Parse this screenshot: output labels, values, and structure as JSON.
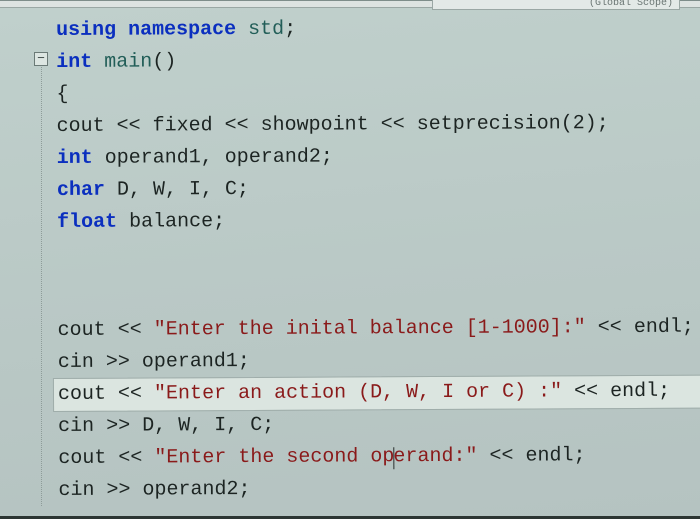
{
  "scope_label": "(Global Scope)",
  "fold_glyph": "−",
  "code": {
    "l1": {
      "kw1": "using",
      "kw2": "namespace",
      "id": "std",
      "end": ";"
    },
    "l2": {
      "kw": "int",
      "fn": "main",
      "paren": "()"
    },
    "l3": "{",
    "l4": {
      "a": "cout ",
      "op1": "<<",
      "b": " fixed ",
      "op2": "<<",
      "c": " showpoint ",
      "op3": "<<",
      "d": " setprecision(",
      "num": "2",
      "e": ");"
    },
    "l5": {
      "kw": "int",
      "rest": " operand1, operand2;"
    },
    "l6": {
      "kw": "char",
      "rest": " D, W, I, C;"
    },
    "l7": {
      "kw": "float",
      "rest": " balance;"
    },
    "l8": {
      "a": "cout ",
      "op1": "<<",
      "sp1": " ",
      "str": "\"Enter the inital balance [1-1000]:\"",
      "sp2": " ",
      "op2": "<<",
      "b": " endl;"
    },
    "l9": {
      "a": "cin ",
      "op": ">>",
      "b": " operand1;"
    },
    "l10": {
      "a": "cout ",
      "op1": "<<",
      "sp1": " ",
      "str": "\"Enter an action (D, W, I or C) :\"",
      "sp2": " ",
      "op2": "<<",
      "b": " endl;"
    },
    "l11": {
      "a": "cin ",
      "op": ">>",
      "b": " D, W, I, C;"
    },
    "l12": {
      "a": "cout ",
      "op1": "<<",
      "sp1": " ",
      "str1": "\"Enter the second op",
      "mid": "e",
      "str2": "rand:\"",
      "sp2": " ",
      "op2": "<<",
      "b": " endl;"
    },
    "l13": {
      "a": "cin ",
      "op": ">>",
      "b": " operand2;"
    }
  }
}
